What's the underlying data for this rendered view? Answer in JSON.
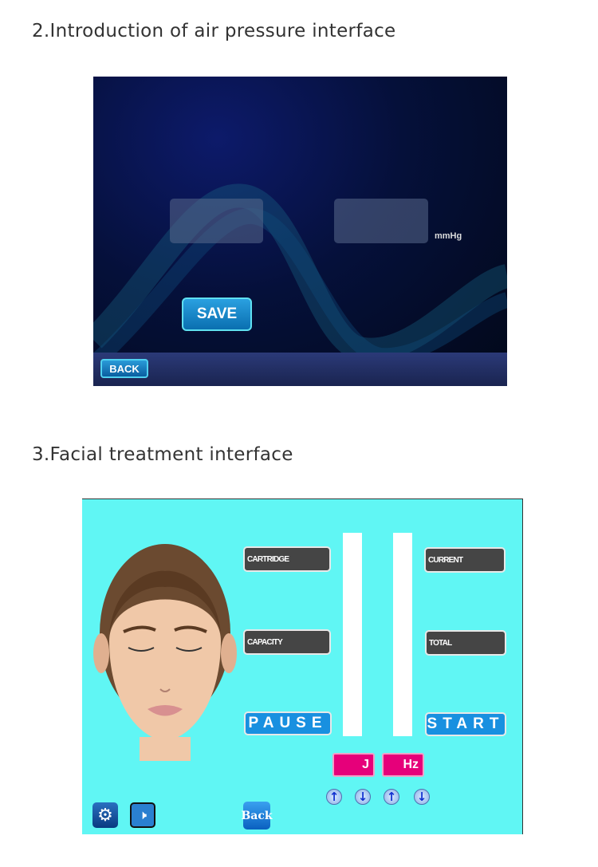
{
  "section1": {
    "title": "2.Introduction of air pressure interface",
    "unit": "mmHg",
    "save_label": "SAVE",
    "back_label": "BACK"
  },
  "section2": {
    "title": "3.Facial treatment interface",
    "cartridge_label": "CARTRIDGE",
    "capacity_label": "CAPACITY",
    "current_label": "CURRENT",
    "total_label": "TOTAL",
    "pause_label": "PAUSE",
    "start_label": "START",
    "energy_unit": "J",
    "frequency_unit": "Hz",
    "back_label": "Back",
    "icons": [
      "gear-icon",
      "speaker-icon",
      "arrow-up-icon",
      "arrow-down-icon"
    ],
    "colors": {
      "background": "#60f6f4",
      "accent": "#1890e0",
      "unit_box": "#e6007a",
      "display_box": "#454545"
    }
  }
}
